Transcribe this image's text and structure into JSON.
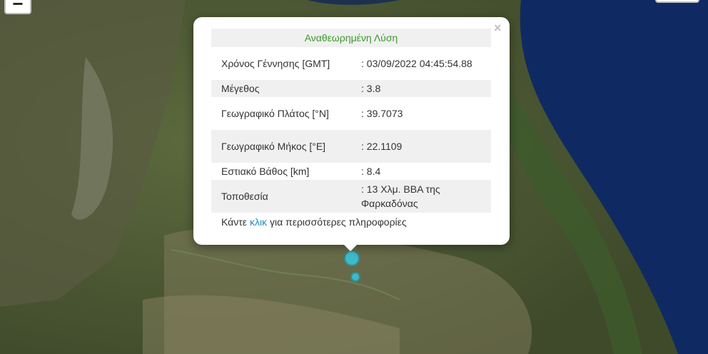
{
  "map": {
    "zoom_out_label": "−",
    "colors": {
      "land": "#4f5a36",
      "sea": "#0f2a63",
      "marker": "#3fb9c4"
    }
  },
  "popup": {
    "close_label": "×",
    "header": "Αναθεωρημένη Λύση",
    "rows": [
      {
        "label": "Χρόνος Γέννησης [GMT]",
        "value": ": 03/09/2022 04:45:54.88"
      },
      {
        "label": "Μέγεθος",
        "value": ": 3.8"
      },
      {
        "label": "Γεωγραφικό Πλάτος [°N]",
        "value": ": 39.7073"
      },
      {
        "label": "Γεωγραφικό Μήκος [°E]",
        "value": ": 22.1109"
      },
      {
        "label": "Εστιακό Βάθος [km]",
        "value": ": 8.4"
      },
      {
        "label": "Τοποθεσία",
        "value": ": 13 Χλμ. ΒΒΑ της Φαρκαδόνας"
      }
    ],
    "more": {
      "prefix": "Κάντε",
      "link": "κλικ",
      "suffix": "για περισσότερες πληροφορίες"
    }
  }
}
